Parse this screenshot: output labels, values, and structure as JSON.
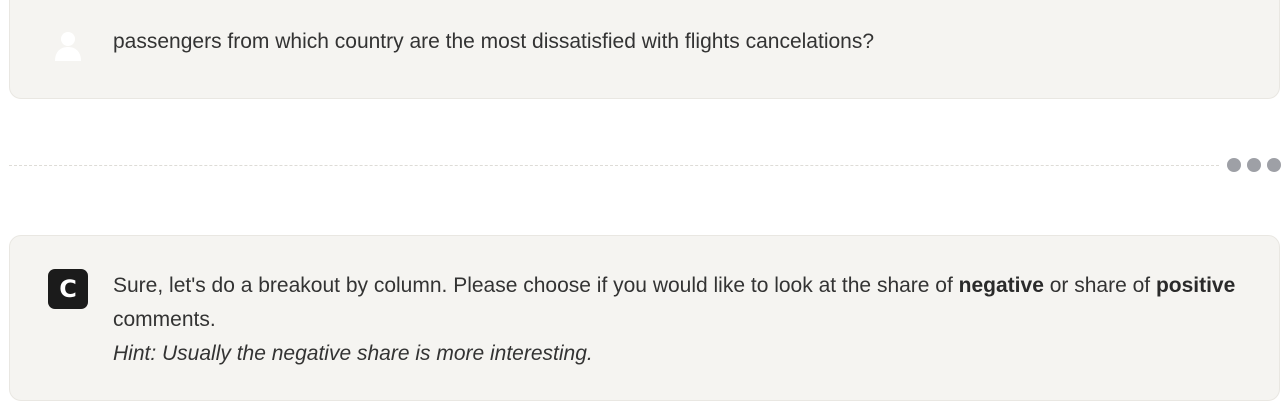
{
  "user_message": {
    "text": "passengers from which country are the most dissatisfied with flights cancelations?",
    "avatar_icon": "user-icon"
  },
  "divider": {
    "menu_icon": "more-dots-icon"
  },
  "assistant_message": {
    "avatar_letter": "C",
    "segments": {
      "part1": "Sure, let's do a breakout by column. Please choose if you would like to look at the share of ",
      "bold1": "negative",
      "part2": " or share of ",
      "bold2": "positive",
      "part3": " comments."
    },
    "hint": "Hint: Usually the negative share is more interesting."
  },
  "colors": {
    "card_background": "#f5f4f1",
    "card_border": "#e9e7e2",
    "assistant_avatar": "#1b1b1b",
    "dots": "#9ea0a6"
  }
}
